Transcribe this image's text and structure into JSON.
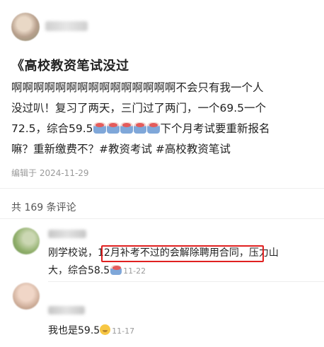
{
  "post": {
    "title": "《高校教资笔试没过",
    "body_line1": "啊啊啊啊啊啊啊啊啊啊啊啊啊啊啊不会只有我一个人",
    "body_line2": "没过叭！复习了两天，三门过了两门，一个69.5一个",
    "body_line3a": "72.5，综合59.5",
    "body_line3b": "下个月考试要重新报名",
    "body_line4": "嘛？重新缴费不？#教资考试 #高校教资笔试",
    "edited": "编辑于 2024-11-29",
    "emoji_count": 5,
    "emoji_name": "crying-face-emoji"
  },
  "comments_header": "共 169 条评论",
  "comments": [
    {
      "text_before": "刚学校说，",
      "text_highlight": "12月补考不过的会解除聘用合同",
      "text_after": "，压力山",
      "text_line2": "大，综合58.5",
      "time": "11-22",
      "highlight_color": "#e02020"
    },
    {
      "text": "我也是59.5",
      "time": "11-17"
    }
  ]
}
